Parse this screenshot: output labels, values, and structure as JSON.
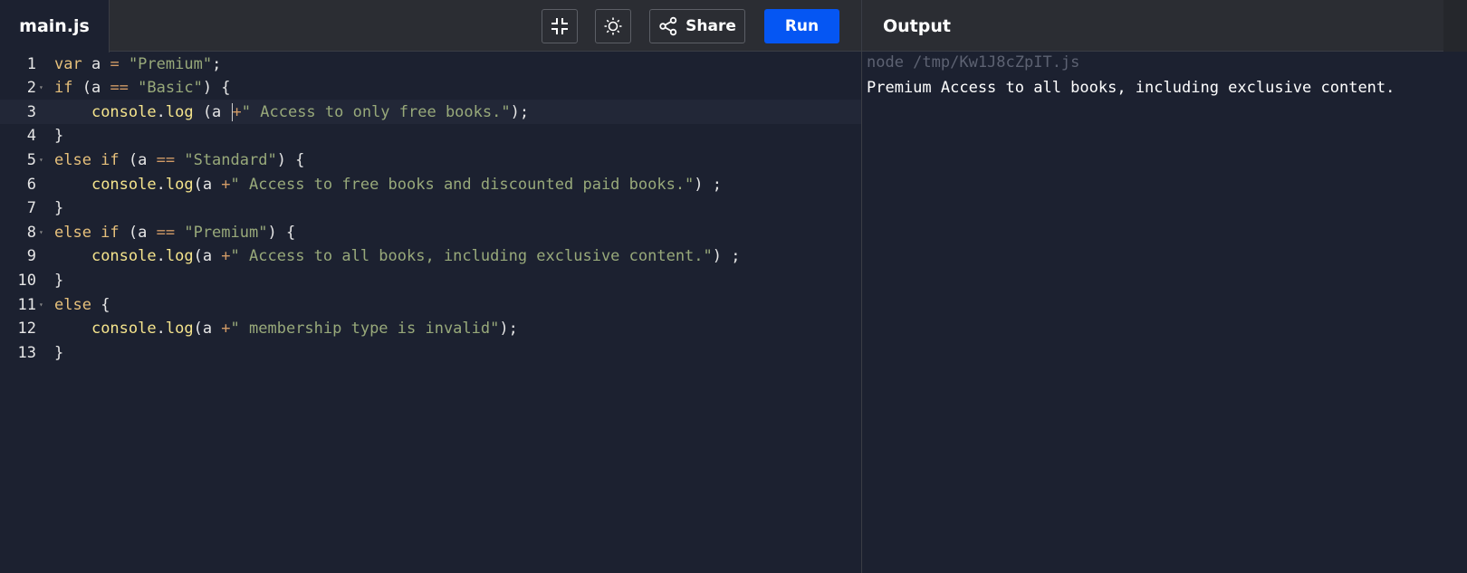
{
  "editor": {
    "file_tab": "main.js",
    "lines": [
      {
        "n": "1",
        "fold": false,
        "tokens": [
          [
            "kw",
            "var"
          ],
          [
            "pl",
            " a "
          ],
          [
            "op",
            "="
          ],
          [
            "pl",
            " "
          ],
          [
            "str",
            "\"Premium\""
          ],
          [
            "pl",
            ";"
          ]
        ]
      },
      {
        "n": "2",
        "fold": true,
        "tokens": [
          [
            "kw",
            "if"
          ],
          [
            "pl",
            " (a "
          ],
          [
            "op",
            "=="
          ],
          [
            "pl",
            " "
          ],
          [
            "str",
            "\"Basic\""
          ],
          [
            "pl",
            ") {"
          ]
        ]
      },
      {
        "n": "3",
        "fold": false,
        "active": true,
        "tokens": [
          [
            "pl",
            "    "
          ],
          [
            "fn",
            "console"
          ],
          [
            "pl",
            "."
          ],
          [
            "fn",
            "log"
          ],
          [
            "pl",
            " (a "
          ],
          [
            "cursor",
            ""
          ],
          [
            "op",
            "+"
          ],
          [
            "str",
            "\" Access to only free books.\""
          ],
          [
            "pl",
            ");"
          ]
        ]
      },
      {
        "n": "4",
        "fold": false,
        "tokens": [
          [
            "pl",
            "}"
          ]
        ]
      },
      {
        "n": "5",
        "fold": true,
        "tokens": [
          [
            "kw",
            "else if"
          ],
          [
            "pl",
            " (a "
          ],
          [
            "op",
            "=="
          ],
          [
            "pl",
            " "
          ],
          [
            "str",
            "\"Standard\""
          ],
          [
            "pl",
            ") {"
          ]
        ]
      },
      {
        "n": "6",
        "fold": false,
        "tokens": [
          [
            "pl",
            "    "
          ],
          [
            "fn",
            "console"
          ],
          [
            "pl",
            "."
          ],
          [
            "fn",
            "log"
          ],
          [
            "pl",
            "(a "
          ],
          [
            "op",
            "+"
          ],
          [
            "str",
            "\" Access to free books and discounted paid books.\""
          ],
          [
            "pl",
            ") ;"
          ]
        ]
      },
      {
        "n": "7",
        "fold": false,
        "tokens": [
          [
            "pl",
            "}"
          ]
        ]
      },
      {
        "n": "8",
        "fold": true,
        "tokens": [
          [
            "kw",
            "else if"
          ],
          [
            "pl",
            " (a "
          ],
          [
            "op",
            "=="
          ],
          [
            "pl",
            " "
          ],
          [
            "str",
            "\"Premium\""
          ],
          [
            "pl",
            ") {"
          ]
        ]
      },
      {
        "n": "9",
        "fold": false,
        "tokens": [
          [
            "pl",
            "    "
          ],
          [
            "fn",
            "console"
          ],
          [
            "pl",
            "."
          ],
          [
            "fn",
            "log"
          ],
          [
            "pl",
            "(a "
          ],
          [
            "op",
            "+"
          ],
          [
            "str",
            "\" Access to all books, including exclusive content.\""
          ],
          [
            "pl",
            ") ;"
          ]
        ]
      },
      {
        "n": "10",
        "fold": false,
        "tokens": [
          [
            "pl",
            "}"
          ]
        ]
      },
      {
        "n": "11",
        "fold": true,
        "tokens": [
          [
            "kw",
            "else"
          ],
          [
            "pl",
            " {"
          ]
        ]
      },
      {
        "n": "12",
        "fold": false,
        "tokens": [
          [
            "pl",
            "    "
          ],
          [
            "fn",
            "console"
          ],
          [
            "pl",
            "."
          ],
          [
            "fn",
            "log"
          ],
          [
            "pl",
            "(a "
          ],
          [
            "op",
            "+"
          ],
          [
            "str",
            "\" membership type is invalid\""
          ],
          [
            "pl",
            ");"
          ]
        ]
      },
      {
        "n": "13",
        "fold": false,
        "tokens": [
          [
            "pl",
            "}"
          ]
        ]
      }
    ]
  },
  "toolbar": {
    "collapse_icon": "collapse-icon",
    "theme_icon": "sun-icon",
    "share_icon": "share-icon",
    "share_label": "Share",
    "run_label": "Run",
    "run_color": "#0556f3"
  },
  "output": {
    "title": "Output",
    "command": "node /tmp/Kw1J8cZpIT.js",
    "lines": [
      "Premium Access to all books, including exclusive content."
    ]
  }
}
